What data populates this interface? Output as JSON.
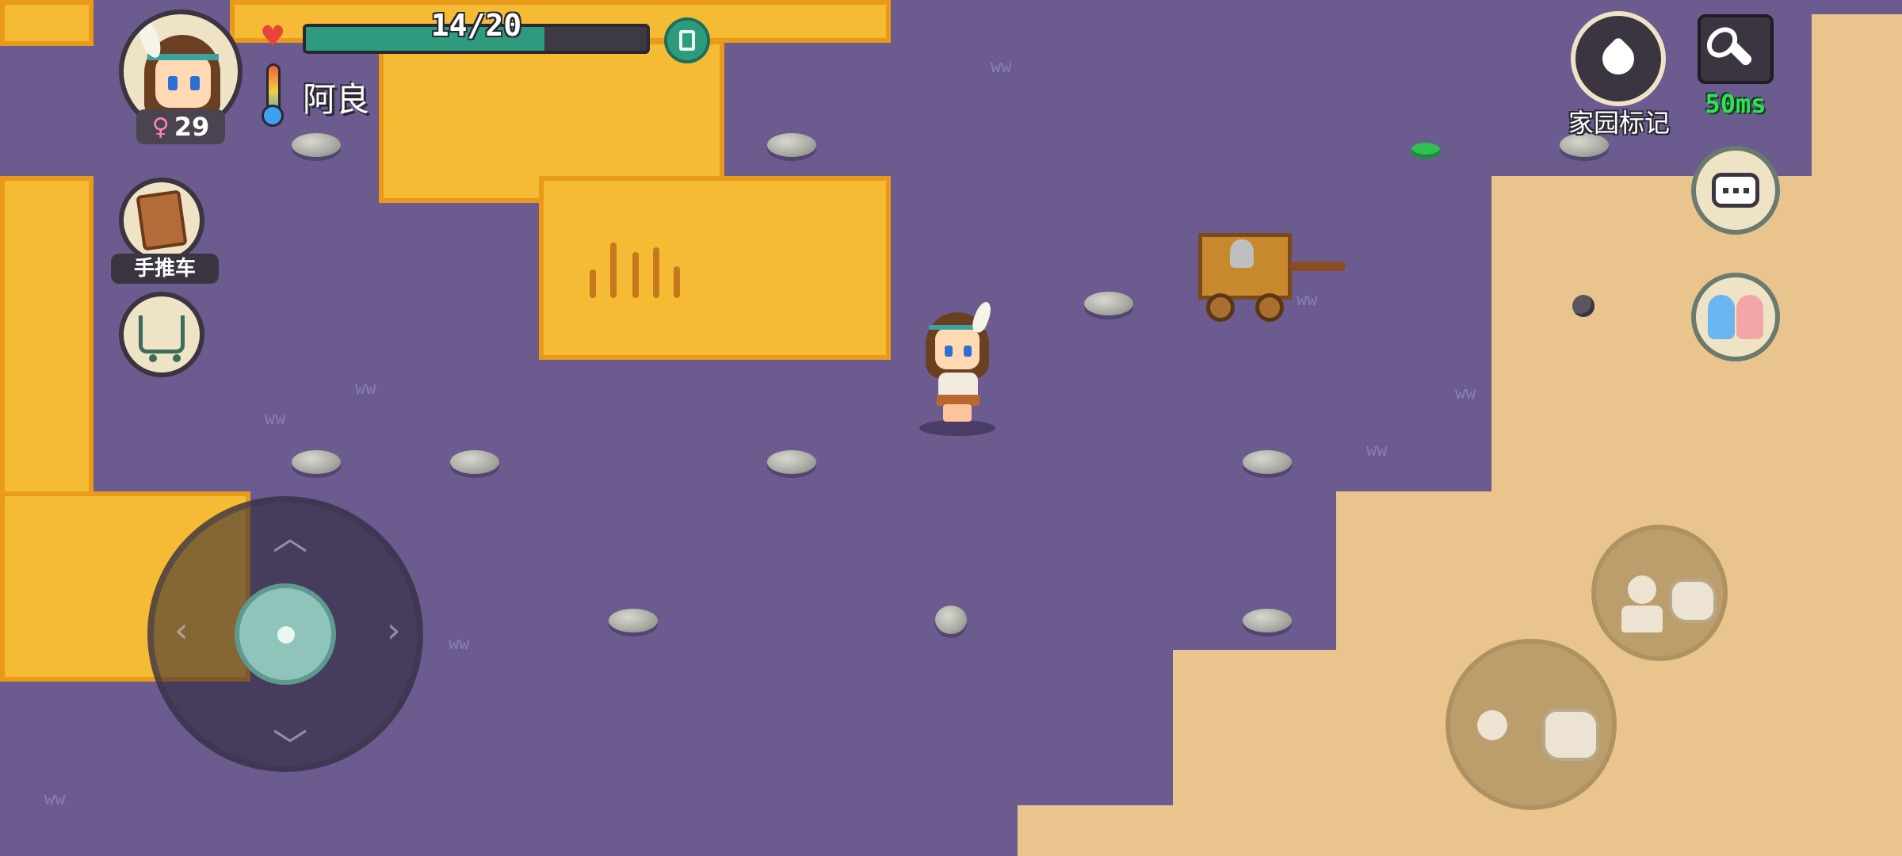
{
  "hud": {
    "health_text": "14/20",
    "health_current": 14,
    "health_max": 20,
    "player_name": "阿良",
    "age": "29",
    "gender_symbol": "♀",
    "cart_label": "手推车",
    "home_marker_label": "家园标记",
    "latency": "50ms"
  },
  "icons": {
    "heart": "heart-icon",
    "trash": "trash-icon",
    "thermometer": "thermometer-icon",
    "book": "recipe-book-icon",
    "shop": "shopping-cart-icon",
    "home": "pin-icon",
    "settings": "wrench-icon",
    "chat": "chat-bubble-icon",
    "social": "friends-icon",
    "throw": "throw-action-icon",
    "give": "give-action-icon"
  },
  "joystick": {
    "up": "︿",
    "down": "﹀",
    "left": "‹",
    "right": "›"
  },
  "colors": {
    "ground_purple": "#6b5b8f",
    "zone_yellow": "#f5bb34",
    "zone_sand": "#e9c58d",
    "health_green": "#2e9b7e",
    "latency_green": "#2fe05a"
  }
}
